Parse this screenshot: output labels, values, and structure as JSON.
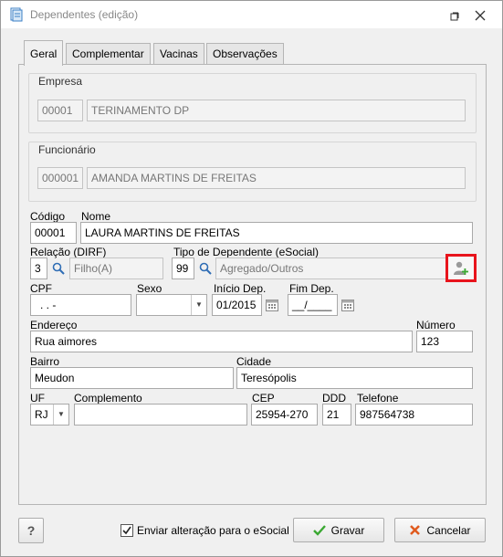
{
  "window": {
    "title": "Dependentes (edição)"
  },
  "tabs": [
    {
      "label": "Geral"
    },
    {
      "label": "Complementar"
    },
    {
      "label": "Vacinas"
    },
    {
      "label": "Observações"
    }
  ],
  "empresa": {
    "group_label": "Empresa",
    "code": "00001",
    "name": "TERINAMENTO DP"
  },
  "funcionario": {
    "group_label": "Funcionário",
    "code": "000001",
    "name": "AMANDA MARTINS DE FREITAS"
  },
  "form": {
    "codigo_label": "Código",
    "codigo": "00001",
    "nome_label": "Nome",
    "nome": "LAURA MARTINS DE FREITAS",
    "relacao_label": "Relação (DIRF)",
    "relacao_code": "3",
    "relacao_desc": "Filho(A)",
    "tipo_label": "Tipo de Dependente (eSocial)",
    "tipo_code": "99",
    "tipo_desc": "Agregado/Outros",
    "cpf_label": "CPF",
    "cpf": ".   .   -",
    "sexo_label": "Sexo",
    "sexo": "",
    "inicio_label": "Início Dep.",
    "inicio": "01/2015",
    "fim_label": "Fim Dep.",
    "fim": "__/____",
    "endereco_label": "Endereço",
    "endereco": "Rua aimores",
    "numero_label": "Número",
    "numero": "123",
    "bairro_label": "Bairro",
    "bairro": "Meudon",
    "cidade_label": "Cidade",
    "cidade": "Teresópolis",
    "uf_label": "UF",
    "uf": "RJ",
    "complemento_label": "Complemento",
    "complemento": "",
    "cep_label": "CEP",
    "cep": "25954-270",
    "ddd_label": "DDD",
    "ddd": "21",
    "telefone_label": "Telefone",
    "telefone": "987564738"
  },
  "footer": {
    "help": "?",
    "checkbox_label": "Enviar alteração para o eSocial",
    "checkbox_checked": true,
    "save_label": "Gravar",
    "cancel_label": "Cancelar"
  },
  "colors": {
    "highlight": "#e8141c",
    "save_check": "#3aa832",
    "cancel_x": "#e05a1e"
  }
}
